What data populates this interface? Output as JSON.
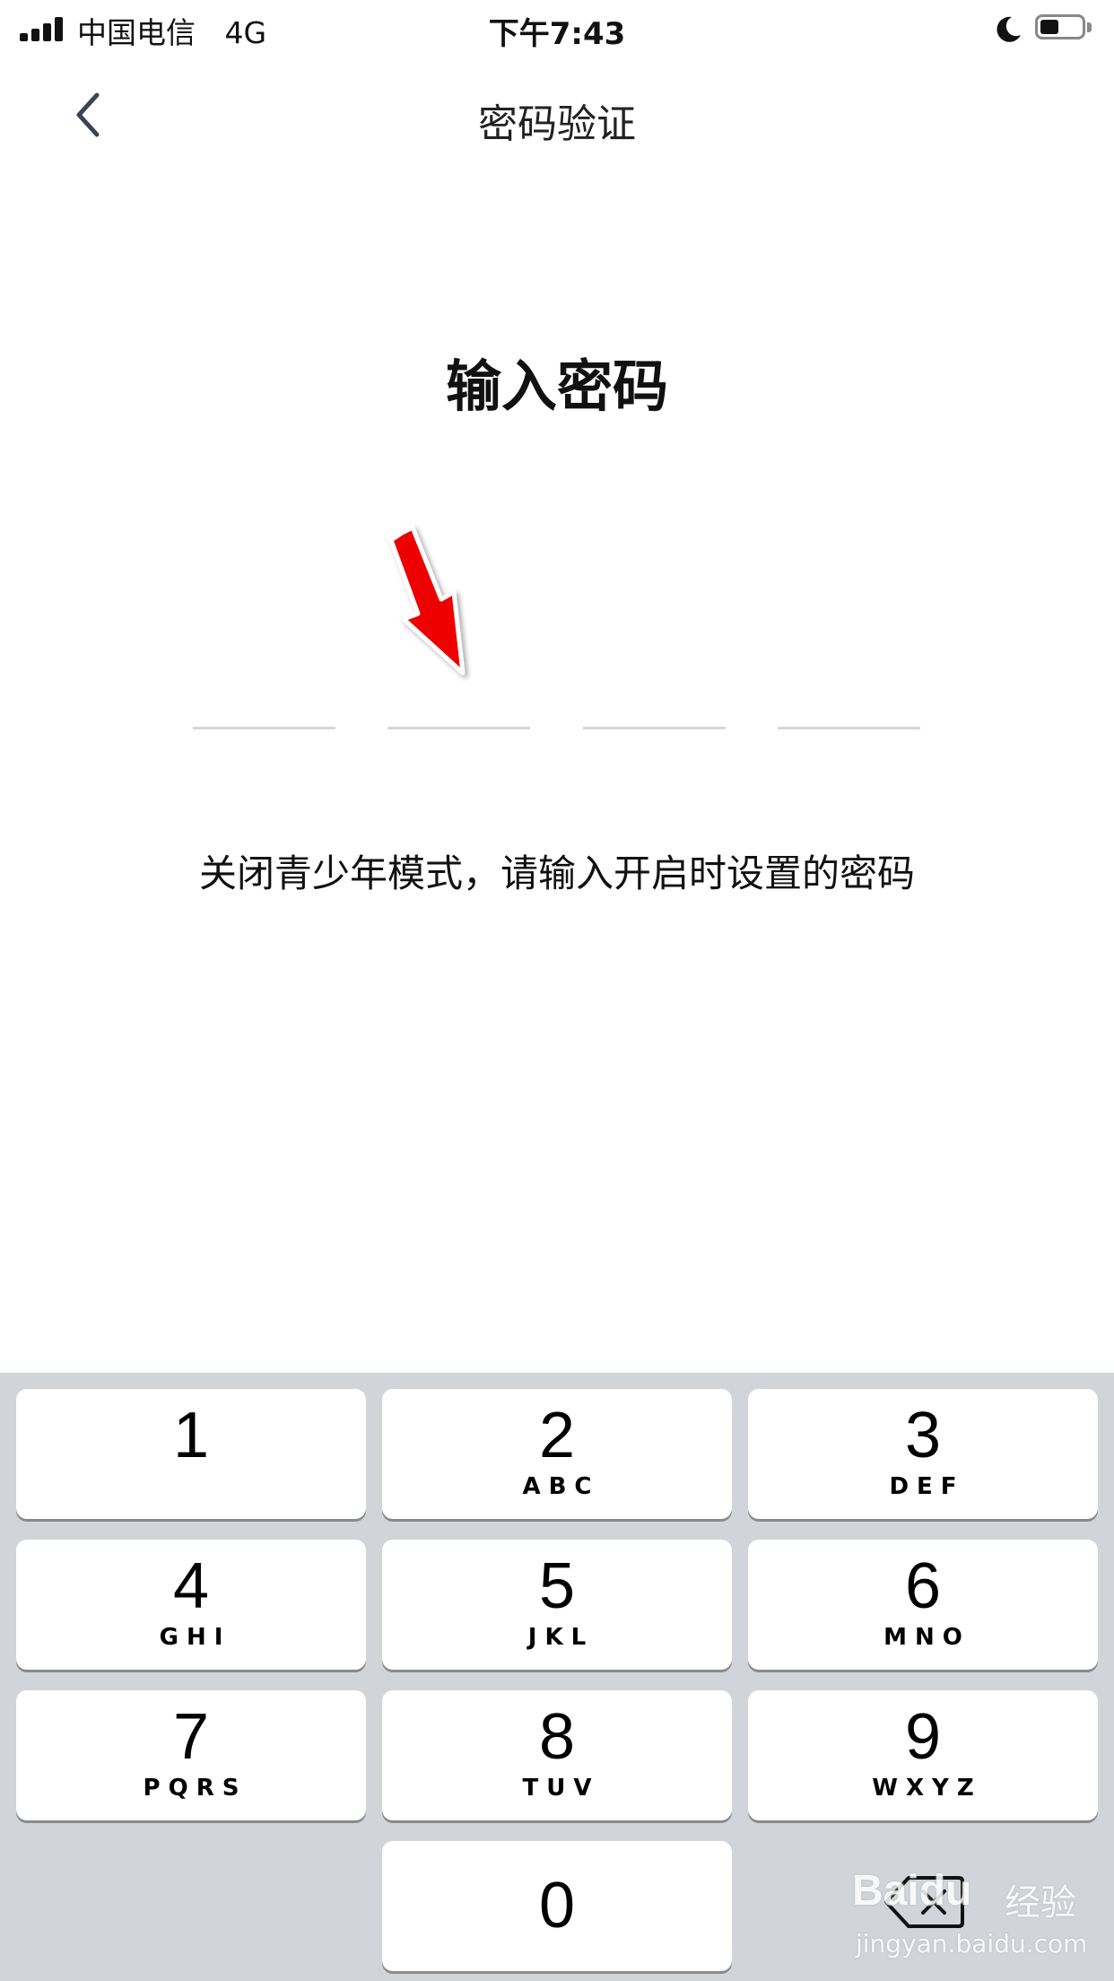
{
  "status_bar": {
    "carrier": "中国电信",
    "network": "4G",
    "time": "下午7:43",
    "battery_level": 0.45
  },
  "nav": {
    "title": "密码验证"
  },
  "main": {
    "heading": "输入密码",
    "pin_length": 4,
    "hint": "关闭青少年模式，请输入开启时设置的密码"
  },
  "keypad": {
    "keys": [
      {
        "digit": "1",
        "letters": ""
      },
      {
        "digit": "2",
        "letters": "ABC"
      },
      {
        "digit": "3",
        "letters": "DEF"
      },
      {
        "digit": "4",
        "letters": "GHI"
      },
      {
        "digit": "5",
        "letters": "JKL"
      },
      {
        "digit": "6",
        "letters": "MNO"
      },
      {
        "digit": "7",
        "letters": "PQRS"
      },
      {
        "digit": "8",
        "letters": "TUV"
      },
      {
        "digit": "9",
        "letters": "WXYZ"
      },
      {
        "digit": "0",
        "letters": ""
      }
    ],
    "backspace_icon": "backspace-icon"
  },
  "annotation": {
    "arrow_color": "#ee0000"
  },
  "watermark": {
    "logo": "Baidu",
    "brand": "经验",
    "url": "jingyan.baidu.com"
  },
  "colors": {
    "keypad_bg": "#d1d4d9",
    "pin_line": "#d6d6d6"
  }
}
